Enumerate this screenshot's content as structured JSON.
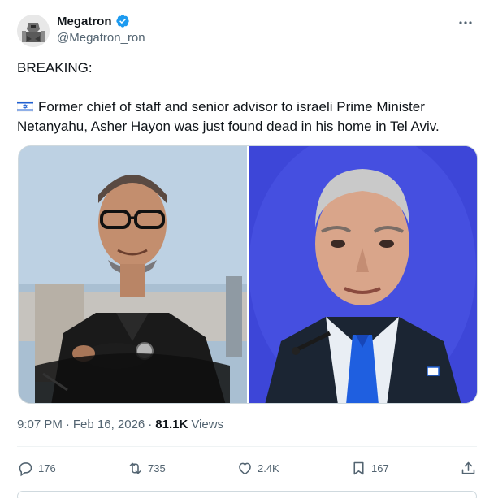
{
  "author": {
    "display_name": "Megatron",
    "handle": "@Megatron_ron",
    "verified_icon": "verified-badge-icon",
    "verified_color": "#1d9bf0"
  },
  "tweet": {
    "headline": "BREAKING:",
    "body": "Former chief of staff and senior advisor to israeli Prime Minister Netanyahu, Asher Hayon was just found dead in his home in Tel Aviv.",
    "flag_icon": "israel-flag-icon"
  },
  "meta": {
    "time": "9:07 PM",
    "separator": "·",
    "date": "Feb 16, 2026",
    "views_count": "81.1K",
    "views_label": "Views"
  },
  "actions": {
    "replies": "176",
    "reposts": "735",
    "likes": "2.4K",
    "bookmarks": "167"
  },
  "colors": {
    "text_primary": "#0f1419",
    "text_secondary": "#536471",
    "border": "#cfd9de"
  }
}
